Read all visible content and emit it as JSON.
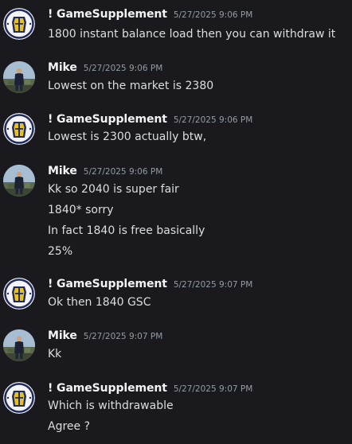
{
  "colors": {
    "background": "#1a1a1e",
    "username": "#f2f3f5",
    "timestamp": "#949ba4",
    "text": "#dbdee1"
  },
  "messages": [
    {
      "author": "! GameSupplement",
      "avatar": "gamesupplement-logo-avatar",
      "timestamp": "5/27/2025 9:06 PM",
      "lines": [
        "1800 instant balance load then you can withdraw it"
      ]
    },
    {
      "author": "Mike",
      "avatar": "mike-photo-avatar",
      "timestamp": "5/27/2025 9:06 PM",
      "lines": [
        "Lowest on the market is 2380"
      ]
    },
    {
      "author": "! GameSupplement",
      "avatar": "gamesupplement-logo-avatar",
      "timestamp": "5/27/2025 9:06 PM",
      "lines": [
        "Lowest is 2300 actually btw,"
      ]
    },
    {
      "author": "Mike",
      "avatar": "mike-photo-avatar",
      "timestamp": "5/27/2025 9:06 PM",
      "lines": [
        "Kk so 2040 is super fair",
        "1840* sorry",
        "In fact 1840 is free basically",
        "25%"
      ]
    },
    {
      "author": "! GameSupplement",
      "avatar": "gamesupplement-logo-avatar",
      "timestamp": "5/27/2025 9:07 PM",
      "lines": [
        "Ok then 1840 GSC"
      ]
    },
    {
      "author": "Mike",
      "avatar": "mike-photo-avatar",
      "timestamp": "5/27/2025 9:07 PM",
      "lines": [
        "Kk"
      ]
    },
    {
      "author": "! GameSupplement",
      "avatar": "gamesupplement-logo-avatar",
      "timestamp": "5/27/2025 9:07 PM",
      "lines": [
        "Which is withdrawable",
        "Agree ?"
      ]
    }
  ]
}
